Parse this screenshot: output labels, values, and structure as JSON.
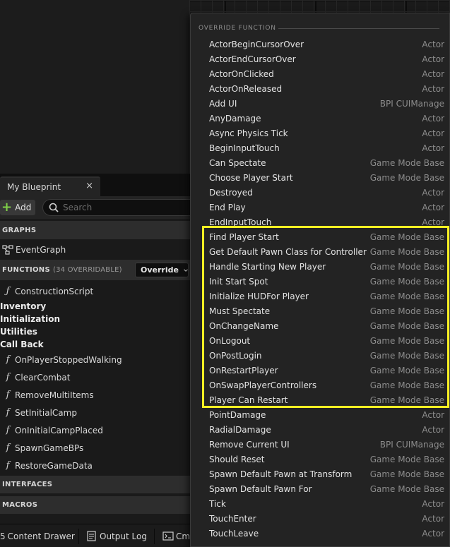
{
  "blueprint_panel": {
    "tab_label": "My Blueprint",
    "tab_close": "×",
    "add_label": "Add",
    "search_placeholder": "Search",
    "graphs_header": "GRAPHS",
    "event_graph": "EventGraph",
    "functions_header": "FUNCTIONS",
    "functions_count": "(34 OVERRIDABLE)",
    "override_label": "Override",
    "construction_script": "ConstructionScript",
    "categories": [
      "Inventory",
      "Initialization",
      "Utilities",
      "Call Back"
    ],
    "functions": [
      "OnPlayerStoppedWalking",
      "ClearCombat",
      "RemoveMultiItems",
      "SetInitialCamp",
      "OnInitialCampPlaced",
      "SpawnGameBPs",
      "RestoreGameData"
    ],
    "interfaces_header": "INTERFACES",
    "macros_header": "MACROS"
  },
  "bottom_bar": {
    "content_drawer": "Content Drawer",
    "output_log": "Output Log",
    "cmd": "Cmd"
  },
  "override_popup": {
    "header": "OVERRIDE FUNCTION",
    "items": [
      {
        "name": "ActorBeginCursorOver",
        "owner": "Actor"
      },
      {
        "name": "ActorEndCursorOver",
        "owner": "Actor"
      },
      {
        "name": "ActorOnClicked",
        "owner": "Actor"
      },
      {
        "name": "ActorOnReleased",
        "owner": "Actor"
      },
      {
        "name": "Add UI",
        "owner": "BPI CUIManage"
      },
      {
        "name": "AnyDamage",
        "owner": "Actor"
      },
      {
        "name": "Async Physics Tick",
        "owner": "Actor"
      },
      {
        "name": "BeginInputTouch",
        "owner": "Actor"
      },
      {
        "name": "Can Spectate",
        "owner": "Game Mode Base"
      },
      {
        "name": "Choose Player Start",
        "owner": "Game Mode Base"
      },
      {
        "name": "Destroyed",
        "owner": "Actor"
      },
      {
        "name": "End Play",
        "owner": "Actor"
      },
      {
        "name": "EndInputTouch",
        "owner": "Actor"
      },
      {
        "name": "Find Player Start",
        "owner": "Game Mode Base"
      },
      {
        "name": "Get Default Pawn Class for Controller",
        "owner": "Game Mode Base"
      },
      {
        "name": "Handle Starting New Player",
        "owner": "Game Mode Base"
      },
      {
        "name": "Init Start Spot",
        "owner": "Game Mode Base"
      },
      {
        "name": "Initialize HUDFor Player",
        "owner": "Game Mode Base"
      },
      {
        "name": "Must Spectate",
        "owner": "Game Mode Base"
      },
      {
        "name": "OnChangeName",
        "owner": "Game Mode Base"
      },
      {
        "name": "OnLogout",
        "owner": "Game Mode Base"
      },
      {
        "name": "OnPostLogin",
        "owner": "Game Mode Base"
      },
      {
        "name": "OnRestartPlayer",
        "owner": "Game Mode Base"
      },
      {
        "name": "OnSwapPlayerControllers",
        "owner": "Game Mode Base"
      },
      {
        "name": "Player Can Restart",
        "owner": "Game Mode Base"
      },
      {
        "name": "PointDamage",
        "owner": "Actor"
      },
      {
        "name": "RadialDamage",
        "owner": "Actor"
      },
      {
        "name": "Remove Current UI",
        "owner": "BPI CUIManage"
      },
      {
        "name": "Should Reset",
        "owner": "Game Mode Base"
      },
      {
        "name": "Spawn Default Pawn at Transform",
        "owner": "Game Mode Base"
      },
      {
        "name": "Spawn Default Pawn For",
        "owner": "Game Mode Base"
      },
      {
        "name": "Tick",
        "owner": "Actor"
      },
      {
        "name": "TouchEnter",
        "owner": "Actor"
      },
      {
        "name": "TouchLeave",
        "owner": "Actor"
      }
    ]
  },
  "colors": {
    "highlight": "#f7ef23",
    "add_accent": "#7fcf48"
  }
}
